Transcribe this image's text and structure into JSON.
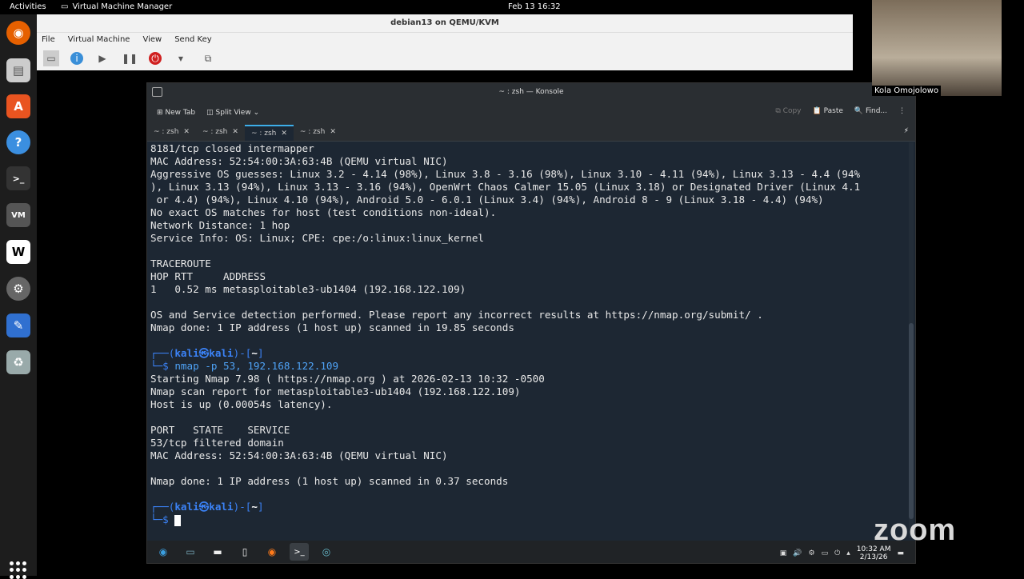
{
  "topbar": {
    "activities": "Activities",
    "app_name": "Virtual Machine Manager",
    "clock": "Feb 13  16:32"
  },
  "vmm": {
    "title": "debian13 on QEMU/KVM",
    "menu": [
      "File",
      "Virtual Machine",
      "View",
      "Send Key"
    ]
  },
  "konsole": {
    "title": "~ : zsh — Konsole",
    "toolbar": {
      "new_tab": "New Tab",
      "split_view": "Split View",
      "copy": "Copy",
      "paste": "Paste",
      "find": "Find..."
    },
    "tabs": [
      "~ : zsh",
      "~ : zsh",
      "~ : zsh",
      "~ : zsh"
    ],
    "active_tab": 2,
    "lines": [
      "8181/tcp closed intermapper",
      "MAC Address: 52:54:00:3A:63:4B (QEMU virtual NIC)",
      "Aggressive OS guesses: Linux 3.2 - 4.14 (98%), Linux 3.8 - 3.16 (98%), Linux 3.10 - 4.11 (94%), Linux 3.13 - 4.4 (94%",
      "), Linux 3.13 (94%), Linux 3.13 - 3.16 (94%), OpenWrt Chaos Calmer 15.05 (Linux 3.18) or Designated Driver (Linux 4.1",
      " or 4.4) (94%), Linux 4.10 (94%), Android 5.0 - 6.0.1 (Linux 3.4) (94%), Android 8 - 9 (Linux 3.18 - 4.4) (94%)",
      "No exact OS matches for host (test conditions non-ideal).",
      "Network Distance: 1 hop",
      "Service Info: OS: Linux; CPE: cpe:/o:linux:linux_kernel",
      "",
      "TRACEROUTE",
      "HOP RTT     ADDRESS",
      "1   0.52 ms metasploitable3-ub1404 (192.168.122.109)",
      "",
      "OS and Service detection performed. Please report any incorrect results at https://nmap.org/submit/ .",
      "Nmap done: 1 IP address (1 host up) scanned in 19.85 seconds",
      ""
    ],
    "prompt_user": "kali㉿kali",
    "prompt_dir": "~",
    "command": "nmap -p 53, 192.168.122.109",
    "output2": [
      "Starting Nmap 7.98 ( https://nmap.org ) at 2026-02-13 10:32 -0500",
      "Nmap scan report for metasploitable3-ub1404 (192.168.122.109)",
      "Host is up (0.00054s latency).",
      "",
      "PORT   STATE    SERVICE",
      "53/tcp filtered domain",
      "MAC Address: 52:54:00:3A:63:4B (QEMU virtual NIC)",
      "",
      "Nmap done: 1 IP address (1 host up) scanned in 0.37 seconds",
      ""
    ],
    "taskbar_time": "10:32 AM",
    "taskbar_date": "2/13/26"
  },
  "zoom": {
    "participant": "Kola Omojolowo",
    "logo": "zoom"
  }
}
